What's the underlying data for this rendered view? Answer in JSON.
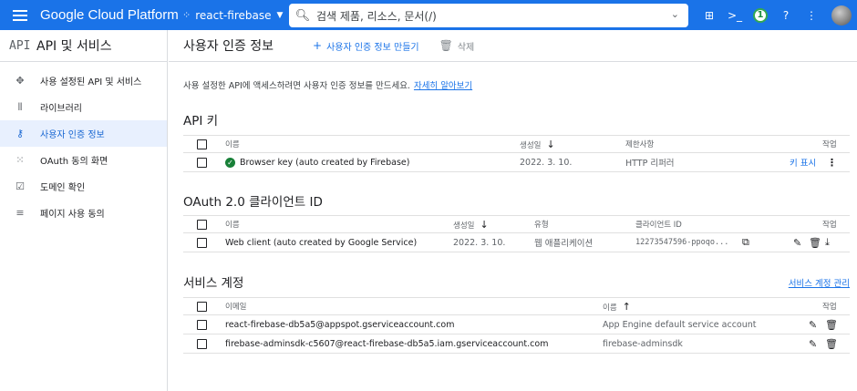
{
  "topbar": {
    "brand": "Google Cloud Platform",
    "project": "react-firebase",
    "search_placeholder": "검색  제품, 리소스, 문서(/)",
    "notification_count": "1"
  },
  "sidebar": {
    "logo": "API",
    "title": "API 및 서비스",
    "items": [
      {
        "label": "사용 설정된 API 및 서비스",
        "icon": "dashboard-icon"
      },
      {
        "label": "라이브러리",
        "icon": "library-icon"
      },
      {
        "label": "사용자 인증 정보",
        "icon": "key-icon"
      },
      {
        "label": "OAuth 동의 화면",
        "icon": "consent-icon"
      },
      {
        "label": "도메인 확인",
        "icon": "domain-check-icon"
      },
      {
        "label": "페이지 사용 동의",
        "icon": "page-agreement-icon"
      }
    ]
  },
  "main": {
    "page_title": "사용자 인증 정보",
    "create_label": "사용자 인증 정보 만들기",
    "delete_label": "삭제",
    "intro_text": "사용 설정한 API에 액세스하려면 사용자 인증 정보를 만드세요.",
    "intro_link": "자세히 알아보기",
    "api_keys": {
      "title": "API 키",
      "headers": {
        "name": "이름",
        "created": "생성일",
        "restrictions": "제한사항",
        "actions": "작업"
      },
      "rows": [
        {
          "name": "Browser key (auto created by Firebase)",
          "created": "2022. 3. 10.",
          "restrictions": "HTTP 리퍼러",
          "show_key": "키 표시"
        }
      ]
    },
    "oauth": {
      "title": "OAuth 2.0 클라이언트 ID",
      "headers": {
        "name": "이름",
        "created": "생성일",
        "type": "유형",
        "client_id": "클라이언트 ID",
        "actions": "작업"
      },
      "rows": [
        {
          "name": "Web client (auto created by Google Service)",
          "created": "2022. 3. 10.",
          "type": "웹 애플리케이션",
          "client_id": "12273547596-ppoqo..."
        }
      ]
    },
    "service_accounts": {
      "title": "서비스 계정",
      "manage_link": "서비스 계정 관리",
      "headers": {
        "email": "이메일",
        "name": "이름",
        "actions": "작업"
      },
      "rows": [
        {
          "email": "react-firebase-db5a5@appspot.gserviceaccount.com",
          "name": "App Engine default service account"
        },
        {
          "email": "firebase-adminsdk-c5607@react-firebase-db5a5.iam.gserviceaccount.com",
          "name": "firebase-adminsdk"
        }
      ]
    }
  }
}
